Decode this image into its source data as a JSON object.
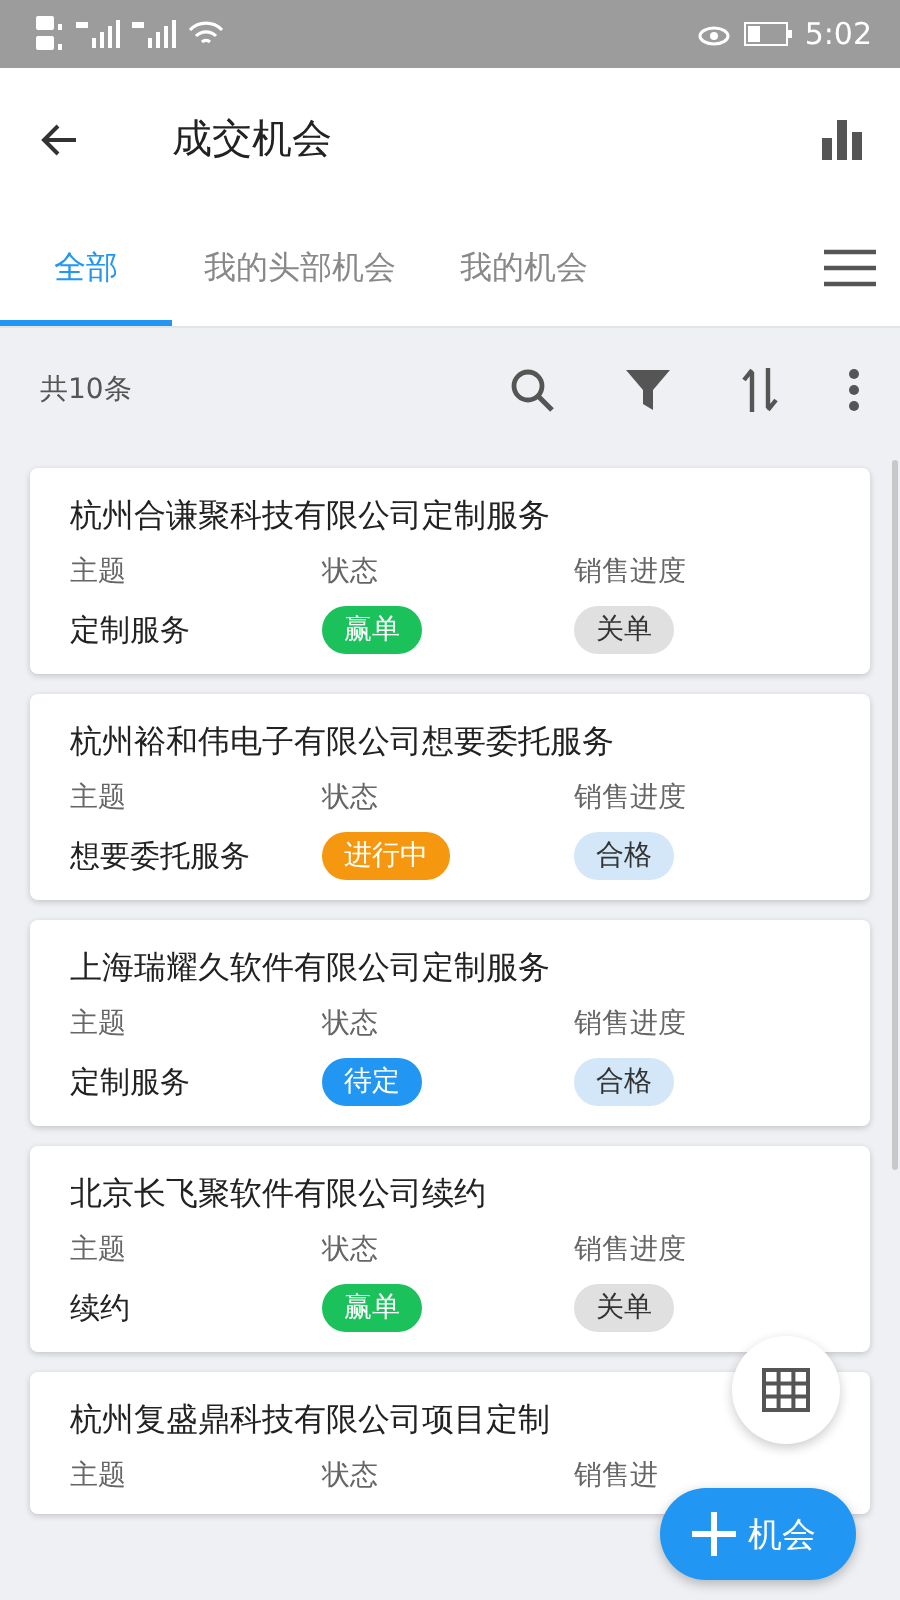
{
  "status_bar": {
    "time": "5:02"
  },
  "app_bar": {
    "title": "成交机会"
  },
  "tabs": [
    {
      "label": "全部",
      "selected": true
    },
    {
      "label": "我的头部机会",
      "selected": false
    },
    {
      "label": "我的机会",
      "selected": false
    }
  ],
  "toolbar": {
    "count": "共10条"
  },
  "cards": [
    {
      "title": "杭州合谦聚科技有限公司定制服务",
      "labels": [
        "主题",
        "状态",
        "销售进度"
      ],
      "subject": "定制服务",
      "status": {
        "text": "赢单",
        "color": "#1bc15a"
      },
      "progress": {
        "text": "关单",
        "color": "#e0e0e0"
      }
    },
    {
      "title": "杭州裕和伟电子有限公司想要委托服务",
      "labels": [
        "主题",
        "状态",
        "销售进度"
      ],
      "subject": "想要委托服务",
      "status": {
        "text": "进行中",
        "color": "#f5980f"
      },
      "progress": {
        "text": "合格",
        "color": "#d3e7f8"
      }
    },
    {
      "title": "上海瑞耀久软件有限公司定制服务",
      "labels": [
        "主题",
        "状态",
        "销售进度"
      ],
      "subject": "定制服务",
      "status": {
        "text": "待定",
        "color": "#2196f3"
      },
      "progress": {
        "text": "合格",
        "color": "#d3e7f8"
      }
    },
    {
      "title": "北京长飞聚软件有限公司续约",
      "labels": [
        "主题",
        "状态",
        "销售进度"
      ],
      "subject": "续约",
      "status": {
        "text": "赢单",
        "color": "#1bc15a"
      },
      "progress": {
        "text": "关单",
        "color": "#e0e0e0"
      }
    },
    {
      "title": "杭州复盛鼎科技有限公司项目定制",
      "labels": [
        "主题",
        "状态",
        "销售进"
      ]
    }
  ],
  "fab": {
    "label": "机会"
  }
}
